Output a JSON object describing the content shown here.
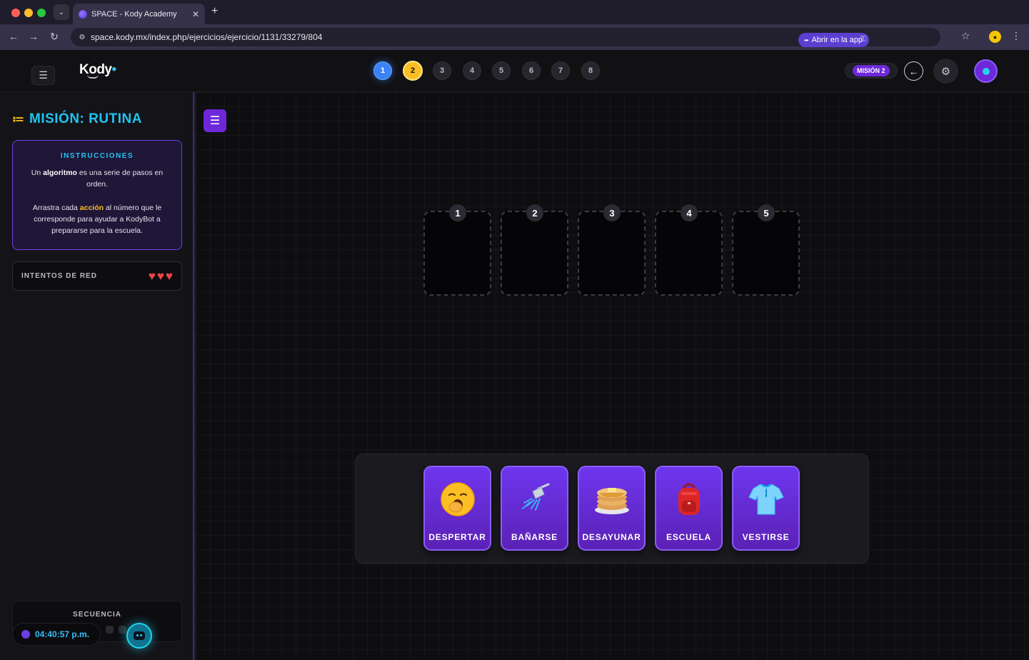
{
  "browser": {
    "tab_title": "SPACE - Kody Academy",
    "url": "space.kody.mx/index.php/ejercicios/ejercicio/1131/33279/804",
    "open_app_label": "Abrir en la app"
  },
  "header": {
    "logo": "Kody",
    "steps": [
      "1",
      "2",
      "3",
      "4",
      "5",
      "6",
      "7",
      "8"
    ],
    "active_step": "1",
    "current_step": "2",
    "mission_badge": "MISIÓN 2"
  },
  "sidebar": {
    "mission_title": "MISIÓN: RUTINA",
    "instructions": {
      "title": "INSTRUCCIONES",
      "p1_pre": "Un ",
      "p1_bold": "algoritmo",
      "p1_post": " es una serie de pasos en orden.",
      "p2_pre": "Arrastra cada ",
      "p2_accent": "acción",
      "p2_post": " al número que le corresponde para ayudar a KodyBot a prepararse para la escuela."
    },
    "attempts": {
      "label": "INTENTOS DE RED",
      "hearts": 3
    },
    "sequence": {
      "label": "SECUENCIA"
    },
    "clock": "04:40:57 p.m."
  },
  "main": {
    "slots": [
      "1",
      "2",
      "3",
      "4",
      "5"
    ],
    "cards": [
      {
        "label": "DESPERTAR",
        "icon": "yawning-face-icon"
      },
      {
        "label": "BAÑARSE",
        "icon": "shower-icon"
      },
      {
        "label": "DESAYUNAR",
        "icon": "pancakes-icon"
      },
      {
        "label": "ESCUELA",
        "icon": "backpack-icon"
      },
      {
        "label": "VESTIRSE",
        "icon": "tshirt-icon"
      }
    ]
  },
  "colors": {
    "accent_cyan": "#22c3f0",
    "accent_purple": "#6d28d9",
    "accent_yellow": "#fbbf24",
    "heart_red": "#ef4444"
  }
}
